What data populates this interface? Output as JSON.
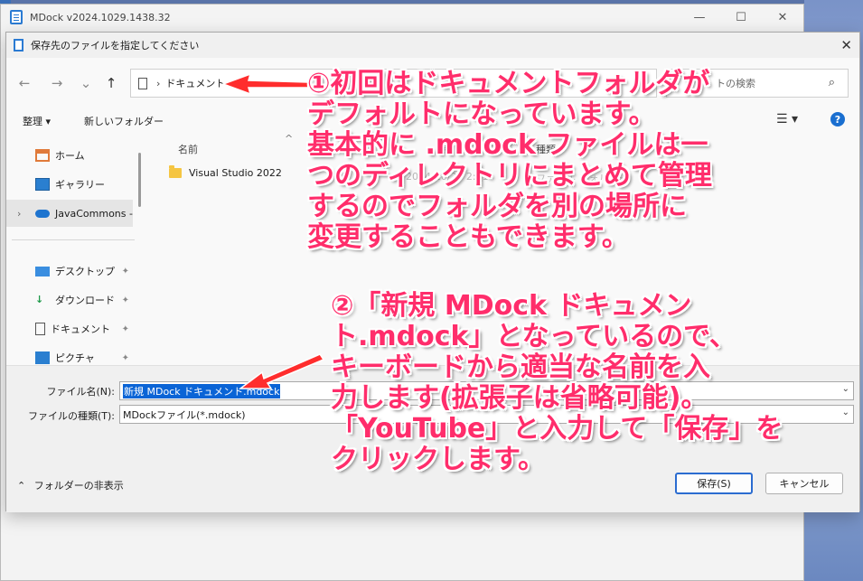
{
  "app": {
    "title": "MDock v2024.1029.1438.32",
    "minimize": "—",
    "maximize": "☐",
    "close": "✕"
  },
  "dialog": {
    "title": "保存先のファイルを指定してください",
    "close": "✕",
    "nav": {
      "back": "←",
      "forward": "→",
      "recent": "⌄",
      "up": "↑"
    },
    "address": {
      "chevron": "›",
      "location": "ドキュメント"
    },
    "search": {
      "placeholder": "ドキュメントの検索",
      "visible_text": "トの検索"
    },
    "toolbar": {
      "organize": "整理 ▾",
      "new_folder": "新しいフォルダー",
      "view": "☰ ▾",
      "help": "?"
    },
    "sidebar": {
      "items": [
        {
          "label": "ホーム",
          "icon": "home-icon"
        },
        {
          "label": "ギャラリー",
          "icon": "gallery-icon"
        },
        {
          "label": "JavaCommons -",
          "icon": "cloud-icon"
        },
        {
          "label": "デスクトップ",
          "icon": "desktop-icon"
        },
        {
          "label": "ダウンロード",
          "icon": "download-icon"
        },
        {
          "label": "ドキュメント",
          "icon": "document-icon"
        },
        {
          "label": "ピクチャ",
          "icon": "picture-icon"
        }
      ],
      "expand_chevron": "›",
      "pin": "📌"
    },
    "columns": {
      "name": "名前",
      "sort_arrow": "^",
      "date_partial": "時",
      "type_partial": "種類"
    },
    "files": [
      {
        "name": "Visual Studio 2022",
        "date_partial": "2024/10/29 2:51",
        "type_partial": "ファイル フォルダー"
      }
    ],
    "filename_label": "ファイル名(N):",
    "filename_value": "新規 MDock ドキュメント.mdock",
    "filetype_label": "ファイルの種類(T):",
    "filetype_value": "MDockファイル(*.mdock)",
    "hide_folders": "フォルダーの非表示",
    "hide_chevron": "⌃",
    "save_button": "保存(S)",
    "cancel_button": "キャンセル"
  },
  "annotations": {
    "note1": [
      "①初回はドキュメントフォルダが",
      "デフォルトになっています。",
      "基本的に .mdock ファイルは一",
      "つのディレクトリにまとめて管理",
      "するのでフォルダを別の場所に",
      "変更することもできます。"
    ],
    "note2": [
      "②「新規 MDock ドキュメン",
      "ト.mdock」となっているので、",
      "キーボードから適当な名前を入",
      "力します(拡張子は省略可能)。",
      "「YouTube」と入力して「保存」を",
      "クリックします。"
    ],
    "color": "#ff2d6b"
  }
}
